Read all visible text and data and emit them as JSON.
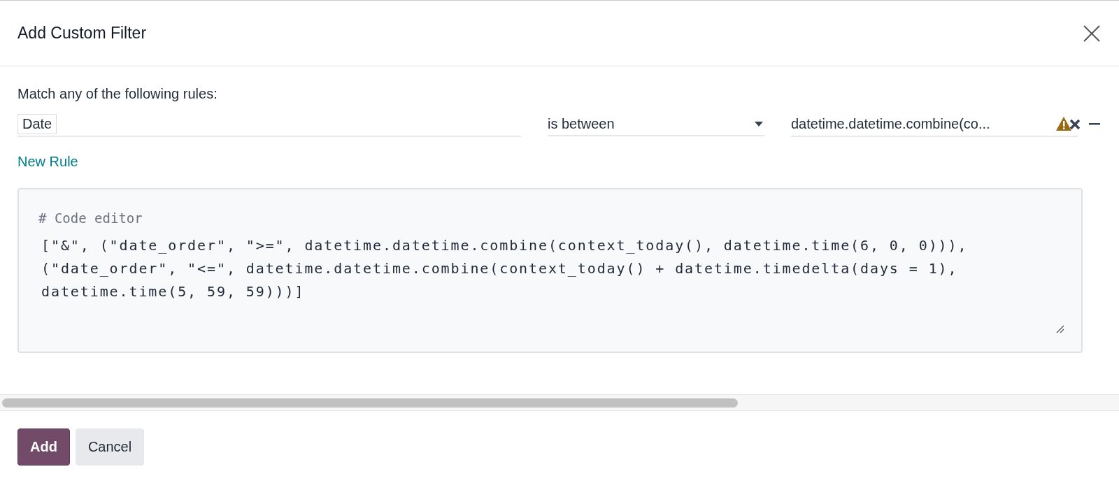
{
  "dialog": {
    "title": "Add Custom Filter"
  },
  "match_text": "Match any of the following rules:",
  "rules": [
    {
      "field": "Date",
      "operator": "is between",
      "value": "datetime.datetime.combine(co..."
    }
  ],
  "new_rule": "New Rule",
  "code_editor": {
    "comment": "# Code editor",
    "lines": [
      "[\"&\", (\"date_order\", \">=\", datetime.datetime.combine(context_today(), datetime.time(6, 0, 0))),",
      "(\"date_order\", \"<=\", datetime.datetime.combine(context_today() + datetime.timedelta(days = 1),",
      "datetime.time(5, 59, 59)))]"
    ]
  },
  "buttons": [
    {
      "label": "Add",
      "kind": "primary"
    },
    {
      "label": "Cancel",
      "kind": "secondary"
    }
  ]
}
